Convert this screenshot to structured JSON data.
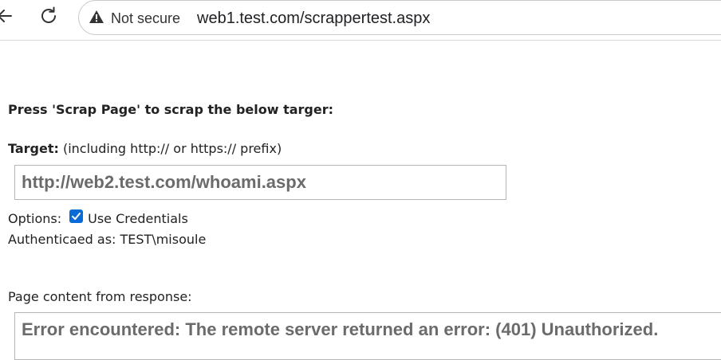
{
  "browser": {
    "back_icon": "arrow-left-icon",
    "reload_icon": "reload-icon",
    "security_icon": "warning-triangle-icon",
    "security_label": "Not secure",
    "url": "web1.test.com/scrappertest.aspx"
  },
  "page": {
    "heading": "Press 'Scrap Page' to scrap the below targer:",
    "target_label": "Target:",
    "target_hint": " (including http:// or https:// prefix)",
    "target_value": "http://web2.test.com/whoami.aspx",
    "options_label": "Options:",
    "use_credentials_label": "Use Credentials",
    "use_credentials_checked": true,
    "authenticated_as": "Authenticaed as: TEST\\misoule",
    "response_label": "Page content from response:",
    "response_text": "Error encountered: The remote server returned an error: (401) Unauthorized."
  },
  "colors": {
    "checkbox": "#0b6bd6",
    "input_text": "#6b6b6b"
  }
}
